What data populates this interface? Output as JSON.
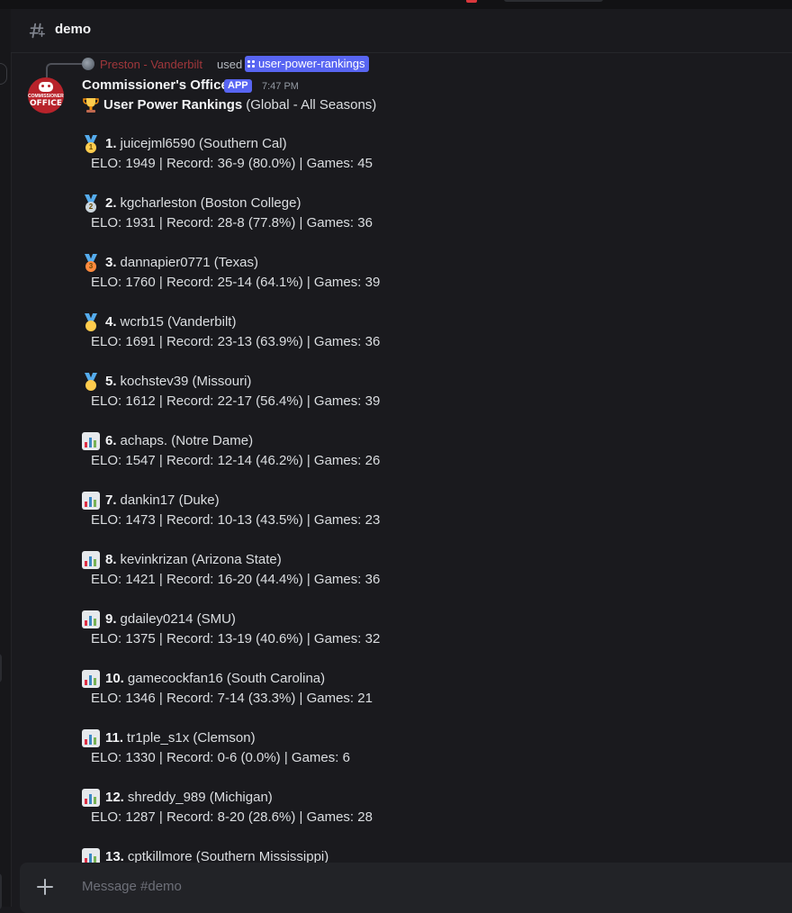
{
  "channel": {
    "name": "demo"
  },
  "reference": {
    "user": "Preston - Vanderbilt",
    "used": "used",
    "command": "user-power-rankings"
  },
  "message": {
    "author": "Commissioner's Office",
    "badge": "APP",
    "timestamp": "7:47 PM",
    "avatar_text": {
      "line1": "COMMISSIONER'S",
      "line2": "OFFICE"
    },
    "title_bold": "User Power Rankings",
    "title_rest": "(Global - All Seasons)",
    "entries": [
      {
        "rank": "1.",
        "name": "juicejml6590 (Southern Cal)",
        "stats": "ELO: 1949 | Record: 36-9 (80.0%) | Games: 45",
        "icon": "medal-1"
      },
      {
        "rank": "2.",
        "name": "kgcharleston (Boston College)",
        "stats": "ELO: 1931 | Record: 28-8 (77.8%) | Games: 36",
        "icon": "medal-2"
      },
      {
        "rank": "3.",
        "name": "dannapier0771 (Texas)",
        "stats": "ELO: 1760 | Record: 25-14 (64.1%) | Games: 39",
        "icon": "medal-3"
      },
      {
        "rank": "4.",
        "name": "wcrb15 (Vanderbilt)",
        "stats": "ELO: 1691 | Record: 23-13 (63.9%) | Games: 36",
        "icon": "medal"
      },
      {
        "rank": "5.",
        "name": "kochstev39 (Missouri)",
        "stats": "ELO: 1612 | Record: 22-17 (56.4%) | Games: 39",
        "icon": "medal"
      },
      {
        "rank": "6.",
        "name": "achaps. (Notre Dame)",
        "stats": "ELO: 1547 | Record: 12-14 (46.2%) | Games: 26",
        "icon": "bar-chart"
      },
      {
        "rank": "7.",
        "name": "dankin17 (Duke)",
        "stats": "ELO: 1473 | Record: 10-13 (43.5%) | Games: 23",
        "icon": "bar-chart"
      },
      {
        "rank": "8.",
        "name": "kevinkrizan (Arizona State)",
        "stats": "ELO: 1421 | Record: 16-20 (44.4%) | Games: 36",
        "icon": "bar-chart"
      },
      {
        "rank": "9.",
        "name": "gdailey0214 (SMU)",
        "stats": "ELO: 1375 | Record: 13-19 (40.6%) | Games: 32",
        "icon": "bar-chart"
      },
      {
        "rank": "10.",
        "name": "gamecockfan16 (South Carolina)",
        "stats": "ELO: 1346 | Record: 7-14 (33.3%) | Games: 21",
        "icon": "bar-chart"
      },
      {
        "rank": "11.",
        "name": "tr1ple_s1x (Clemson)",
        "stats": "ELO: 1330 | Record: 0-6 (0.0%) | Games: 6",
        "icon": "bar-chart"
      },
      {
        "rank": "12.",
        "name": "shreddy_989 (Michigan)",
        "stats": "ELO: 1287 | Record: 8-20 (28.6%) | Games: 28",
        "icon": "bar-chart"
      },
      {
        "rank": "13.",
        "name": "cptkillmore (Southern Mississippi)",
        "stats": "",
        "icon": "bar-chart"
      }
    ]
  },
  "composer": {
    "placeholder": "Message #demo"
  },
  "colors": {
    "blurple": "#5865f2",
    "ref_user": "#a0373b",
    "gold": "#ffcc4d",
    "silver": "#ccd6dd",
    "bronze": "#ff8a3d"
  }
}
